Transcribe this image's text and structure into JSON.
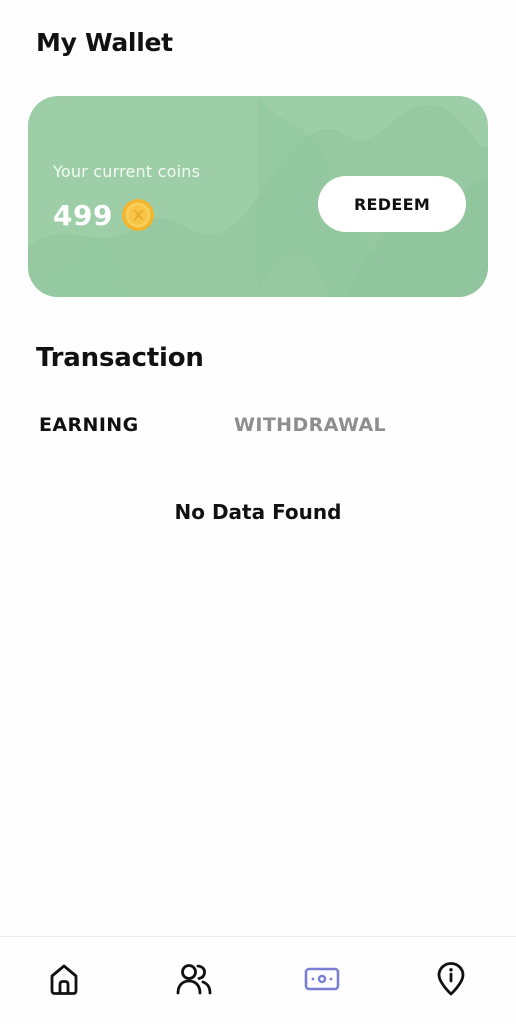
{
  "header": {
    "title": "My Wallet"
  },
  "wallet": {
    "coins_label": "Your current coins",
    "coins_value": "499",
    "coin_icon": "coin-icon",
    "redeem_label": "REDEEM",
    "card_color": "#9dcea8"
  },
  "transactions": {
    "title": "Transaction",
    "tabs": [
      {
        "label": "EARNING",
        "active": true
      },
      {
        "label": "WITHDRAWAL",
        "active": false
      }
    ],
    "empty_message": "No Data Found"
  },
  "bottom_nav": {
    "items": [
      {
        "icon": "home-icon",
        "active": false
      },
      {
        "icon": "users-icon",
        "active": false
      },
      {
        "icon": "wallet-icon",
        "active": true
      },
      {
        "icon": "info-pin-icon",
        "active": false
      }
    ],
    "active_color": "#7b7fd4"
  }
}
